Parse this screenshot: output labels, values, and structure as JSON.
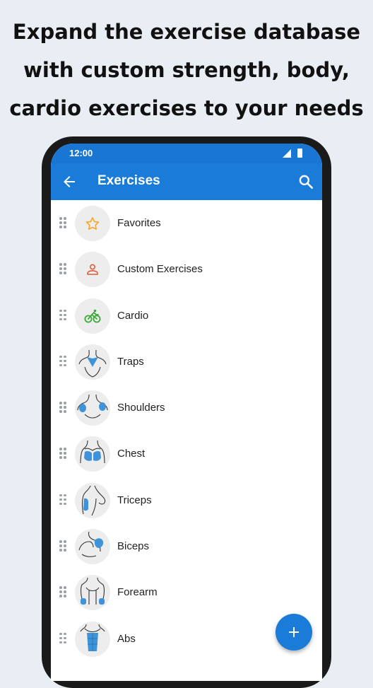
{
  "headline": {
    "line1": "Expand the exercise database",
    "line2": "with custom strength, body,",
    "line3": "cardio exercises to your needs"
  },
  "status": {
    "time": "12:00"
  },
  "appbar": {
    "title": "Exercises"
  },
  "items": [
    {
      "label": "Favorites",
      "icon": "star-icon"
    },
    {
      "label": "Custom Exercises",
      "icon": "person-icon"
    },
    {
      "label": "Cardio",
      "icon": "bicycle-icon"
    },
    {
      "label": "Traps",
      "icon": "traps-muscle-icon"
    },
    {
      "label": "Shoulders",
      "icon": "shoulders-muscle-icon"
    },
    {
      "label": "Chest",
      "icon": "chest-muscle-icon"
    },
    {
      "label": "Triceps",
      "icon": "triceps-muscle-icon"
    },
    {
      "label": "Biceps",
      "icon": "biceps-muscle-icon"
    },
    {
      "label": "Forearm",
      "icon": "forearm-muscle-icon"
    },
    {
      "label": "Abs",
      "icon": "abs-muscle-icon"
    }
  ],
  "colors": {
    "primary": "#1b7bd8",
    "star": "#f5a623",
    "custom": "#e05a3a",
    "cardio": "#3aaa35",
    "muscle": "#3f93d9"
  }
}
